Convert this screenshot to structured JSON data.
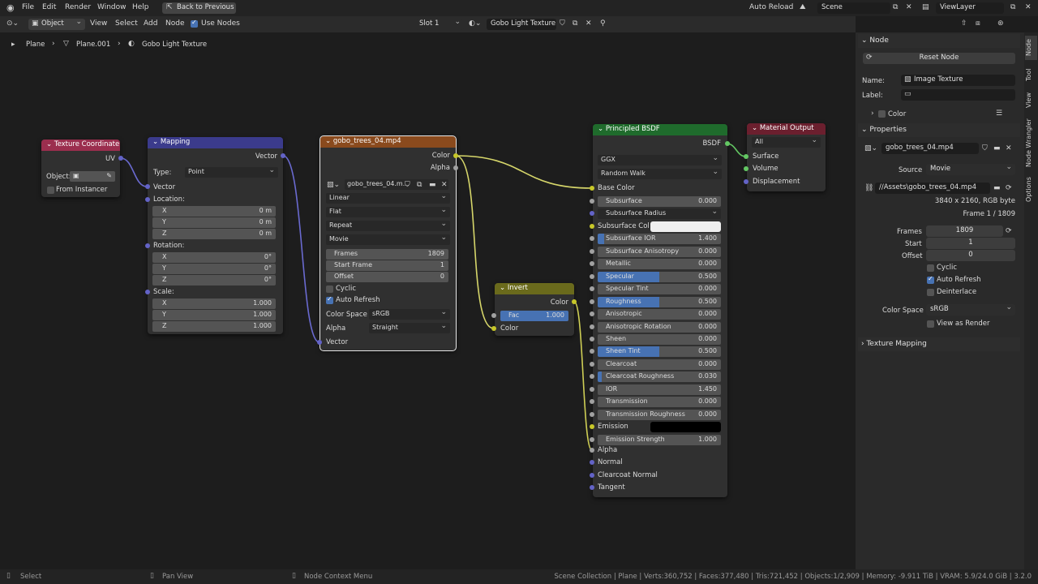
{
  "topbar": {
    "menus": [
      "File",
      "Edit",
      "Render",
      "Window",
      "Help"
    ],
    "back": "Back to Previous",
    "auto_reload": "Auto Reload",
    "scene": "Scene",
    "viewlayer": "ViewLayer"
  },
  "header": {
    "mode": "Object",
    "menus": [
      "View",
      "Select",
      "Add",
      "Node"
    ],
    "use_nodes": "Use Nodes",
    "slot": "Slot 1",
    "material": "Gobo Light Texture"
  },
  "breadcrumb": {
    "a": "Plane",
    "b": "Plane.001",
    "c": "Gobo Light Texture"
  },
  "tc": {
    "title": "Texture Coordinate",
    "uv": "UV",
    "object": "Object:",
    "from_instancer": "From Instancer"
  },
  "mapping": {
    "title": "Mapping",
    "vector_out": "Vector",
    "type_label": "Type:",
    "type": "Point",
    "vector_in": "Vector",
    "location": "Location:",
    "rotation": "Rotation:",
    "scale": "Scale:",
    "x": "X",
    "y": "Y",
    "z": "Z",
    "loc": [
      "0 m",
      "0 m",
      "0 m"
    ],
    "rot": [
      "0°",
      "0°",
      "0°"
    ],
    "scl": [
      "1.000",
      "1.000",
      "1.000"
    ]
  },
  "img": {
    "title": "gobo_trees_04.mp4",
    "color": "Color",
    "alpha": "Alpha",
    "file": "gobo_trees_04.m...",
    "interp": "Linear",
    "proj": "Flat",
    "ext": "Repeat",
    "source": "Movie",
    "frames_l": "Frames",
    "frames": "1809",
    "start_l": "Start Frame",
    "start": "1",
    "offset_l": "Offset",
    "offset": "0",
    "cyclic": "Cyclic",
    "auto_refresh": "Auto Refresh",
    "cs_l": "Color Space",
    "cs": "sRGB",
    "alpha_l": "Alpha",
    "alpha_mode": "Straight",
    "vector": "Vector"
  },
  "inv": {
    "title": "Invert",
    "color_out": "Color",
    "fac_l": "Fac",
    "fac": "1.000",
    "color_in": "Color"
  },
  "bsdf": {
    "title": "Principled BSDF",
    "out": "BSDF",
    "dist": "GGX",
    "sss_method": "Random Walk",
    "base_color": "Base Color",
    "params": [
      {
        "n": "Subsurface",
        "v": "0.000",
        "f": 0
      },
      {
        "n": "Subsurface Radius",
        "v": "",
        "f": 0
      },
      {
        "n": "Subsurface Col",
        "v": "",
        "f": 0
      },
      {
        "n": "Subsurface IOR",
        "v": "1.400",
        "f": 0.05
      },
      {
        "n": "Subsurface Anisotropy",
        "v": "0.000",
        "f": 0
      },
      {
        "n": "Metallic",
        "v": "0.000",
        "f": 0
      },
      {
        "n": "Specular",
        "v": "0.500",
        "f": 0.5
      },
      {
        "n": "Specular Tint",
        "v": "0.000",
        "f": 0
      },
      {
        "n": "Roughness",
        "v": "0.500",
        "f": 0.5
      },
      {
        "n": "Anisotropic",
        "v": "0.000",
        "f": 0
      },
      {
        "n": "Anisotropic Rotation",
        "v": "0.000",
        "f": 0
      },
      {
        "n": "Sheen",
        "v": "0.000",
        "f": 0
      },
      {
        "n": "Sheen Tint",
        "v": "0.500",
        "f": 0.5
      },
      {
        "n": "Clearcoat",
        "v": "0.000",
        "f": 0
      },
      {
        "n": "Clearcoat Roughness",
        "v": "0.030",
        "f": 0.03
      },
      {
        "n": "IOR",
        "v": "1.450",
        "f": 0
      },
      {
        "n": "Transmission",
        "v": "0.000",
        "f": 0
      },
      {
        "n": "Transmission Roughness",
        "v": "0.000",
        "f": 0
      },
      {
        "n": "Emission",
        "v": "",
        "f": 0
      },
      {
        "n": "Emission Strength",
        "v": "1.000",
        "f": 0
      }
    ],
    "alpha": "Alpha",
    "normal": "Normal",
    "cc_normal": "Clearcoat Normal",
    "tangent": "Tangent"
  },
  "mo": {
    "title": "Material Output",
    "target": "All",
    "surface": "Surface",
    "volume": "Volume",
    "displacement": "Displacement"
  },
  "side": {
    "node_hdr": "Node",
    "reset": "Reset Node",
    "name_l": "Name:",
    "name": "Image Texture",
    "label_l": "Label:",
    "color": "Color",
    "props_hdr": "Properties",
    "file": "gobo_trees_04.mp4",
    "source_l": "Source",
    "source": "Movie",
    "path": "//Assets\\gobo_trees_04.mp4",
    "res": "3840 x 2160,  RGB byte",
    "frame": "Frame 1 / 1809",
    "frames_l": "Frames",
    "frames": "1809",
    "start_l": "Start",
    "start": "1",
    "offset_l": "Offset",
    "offset": "0",
    "cyclic": "Cyclic",
    "auto_refresh": "Auto Refresh",
    "deinterlace": "Deinterlace",
    "cs_l": "Color Space",
    "cs": "sRGB",
    "view_render": "View as Render",
    "tex_map": "Texture Mapping",
    "tabs": [
      "Node",
      "Tool",
      "View",
      "Node Wrangler",
      "Options"
    ]
  },
  "status": {
    "select": "Select",
    "pan": "Pan View",
    "ctx": "Node Context Menu",
    "stats": "Scene Collection | Plane | Verts:360,752 | Faces:377,480 | Tris:721,452 | Objects:1/2,909 | Memory: -9.911 TiB | VRAM: 5.9/24.0 GiB | 3.2.0"
  },
  "colors": {
    "tc_head": "#9b2e4e",
    "mapping_head": "#3b3b8c",
    "img_head": "#8a4a1d",
    "invert_head": "#6a6a1c",
    "bsdf_head": "#1f6b2c",
    "mo_head": "#6b1f2e",
    "accent": "#4772b3"
  }
}
